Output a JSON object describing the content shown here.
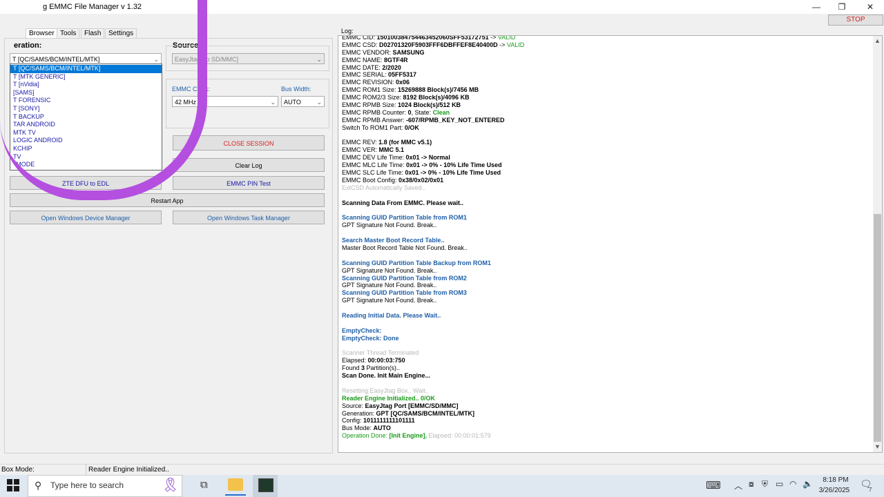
{
  "window": {
    "title": "g EMMC File Manager v 1.32",
    "minimize_glyph": "—",
    "restore_glyph": "❐",
    "close_glyph": "✕",
    "stop_label": "STOP"
  },
  "tabs": [
    "Browser",
    "Tools",
    "Flash",
    "Settings"
  ],
  "left": {
    "generation_label": "eration:",
    "generation_value": "T [QC/SAMS/BCM/INTEL/MTK]",
    "source_label": "Source:",
    "source_value": "EasyJtag Po        SD/MMC]",
    "emmc_clock_label": "EMMC Clock:",
    "emmc_clock_value": "42 MHz",
    "bus_width_label": "Bus Width:",
    "bus_width_value": "AUTO",
    "dropdown_items": [
      "T [QC/SAMS/BCM/INTEL/MTK]",
      "T [MTK GENERIC]",
      "T [nVidia]",
      "[SAMS]",
      "T FORENSIC",
      "T [SONY]",
      "T BACKUP",
      "TAR ANDROID",
      "MTK TV",
      "LOGIC ANDROID",
      "KCHIP",
      "TV",
      "' MODE"
    ],
    "buttons": {
      "close_session": "CLOSE SESSION",
      "clear_log": "Clear Log",
      "zte_dfu": "ZTE DFU to EDL",
      "emmc_pin_test": "EMMC PIN Test",
      "restart_app": "Restart App",
      "open_device_manager": "Open Windows Device Manager",
      "open_task_manager": "Open Windows Task Manager"
    }
  },
  "log": {
    "label": "Log:",
    "lines": [
      {
        "segs": [
          {
            "t": "EMMC CID: "
          },
          {
            "t": "150100384754463452060SFF53172751",
            "c": "b"
          },
          {
            "t": " -> "
          },
          {
            "t": "VALID",
            "c": "gr"
          }
        ]
      },
      {
        "segs": [
          {
            "t": "EMMC CSD: "
          },
          {
            "t": "D02701320F5903FFF6DBFFEF8E40400D",
            "c": "b"
          },
          {
            "t": " -> "
          },
          {
            "t": "VALID",
            "c": "gr"
          }
        ]
      },
      {
        "segs": [
          {
            "t": "EMMC VENDOR: "
          },
          {
            "t": "SAMSUNG",
            "c": "b"
          }
        ]
      },
      {
        "segs": [
          {
            "t": "EMMC NAME: "
          },
          {
            "t": "8GTF4R",
            "c": "b"
          }
        ]
      },
      {
        "segs": [
          {
            "t": "EMMC DATE: "
          },
          {
            "t": "2/2020",
            "c": "b"
          }
        ]
      },
      {
        "segs": [
          {
            "t": "EMMC SERIAL: "
          },
          {
            "t": "05FF5317",
            "c": "b"
          }
        ]
      },
      {
        "segs": [
          {
            "t": "EMMC REVISION: "
          },
          {
            "t": "0x06",
            "c": "b"
          }
        ]
      },
      {
        "segs": [
          {
            "t": "EMMC ROM1 Size: "
          },
          {
            "t": "15269888 Block(s)/7456 MB",
            "c": "b"
          }
        ]
      },
      {
        "segs": [
          {
            "t": "EMMC ROM2/3 Size: "
          },
          {
            "t": "8192 Block(s)/4096 KB",
            "c": "b"
          }
        ]
      },
      {
        "segs": [
          {
            "t": "EMMC RPMB Size: "
          },
          {
            "t": "1024 Block(s)/512 KB",
            "c": "b"
          }
        ]
      },
      {
        "segs": [
          {
            "t": "EMMC RPMB Counter: "
          },
          {
            "t": "0",
            "c": "b"
          },
          {
            "t": ", State: "
          },
          {
            "t": "Clean",
            "c": "grb"
          }
        ]
      },
      {
        "segs": [
          {
            "t": "EMMC RPMB Answer: "
          },
          {
            "t": "-607/RPMB_KEY_NOT_ENTERED",
            "c": "b"
          }
        ]
      },
      {
        "segs": [
          {
            "t": "Switch To ROM1 Part: "
          },
          {
            "t": "0/OK",
            "c": "b"
          }
        ]
      },
      {
        "segs": []
      },
      {
        "segs": [
          {
            "t": "EMMC REV: "
          },
          {
            "t": "1.8 (for MMC v5.1)",
            "c": "b"
          }
        ]
      },
      {
        "segs": [
          {
            "t": "EMMC VER: "
          },
          {
            "t": "MMC 5.1",
            "c": "b"
          }
        ]
      },
      {
        "segs": [
          {
            "t": "EMMC DEV Life Time: "
          },
          {
            "t": "0x01 -> Normal",
            "c": "b"
          }
        ]
      },
      {
        "segs": [
          {
            "t": "EMMC MLC Life Time: "
          },
          {
            "t": "0x01 -> 0% - 10% Life Time Used",
            "c": "b"
          }
        ]
      },
      {
        "segs": [
          {
            "t": "EMMC SLC Life Time: "
          },
          {
            "t": "0x01 -> 0% - 10% Life Time Used",
            "c": "b"
          }
        ]
      },
      {
        "segs": [
          {
            "t": "EMMC Boot Config: "
          },
          {
            "t": "0x38/0x02/0x01",
            "c": "b"
          }
        ]
      },
      {
        "segs": [
          {
            "t": "ExtCSD Automatically Saved..",
            "c": "gy"
          }
        ]
      },
      {
        "segs": []
      },
      {
        "segs": [
          {
            "t": "Scanning Data From EMMC. Please wait..",
            "c": "b"
          }
        ]
      },
      {
        "segs": []
      },
      {
        "segs": [
          {
            "t": "Scanning GUID Partition Table from ROM1",
            "c": "bl"
          }
        ]
      },
      {
        "segs": [
          {
            "t": "GPT Signature Not Found. Break.."
          }
        ]
      },
      {
        "segs": []
      },
      {
        "segs": [
          {
            "t": "Search Master Boot Record Table..",
            "c": "bl"
          }
        ]
      },
      {
        "segs": [
          {
            "t": "Master Boot Record Table Not Found. Break.."
          }
        ]
      },
      {
        "segs": []
      },
      {
        "segs": [
          {
            "t": "Scanning GUID Partition Table Backup from ROM1",
            "c": "bl"
          }
        ]
      },
      {
        "segs": [
          {
            "t": "GPT Signature Not Found. Break.."
          }
        ]
      },
      {
        "segs": [
          {
            "t": "Scanning GUID Partition Table from ROM2",
            "c": "bl"
          }
        ]
      },
      {
        "segs": [
          {
            "t": "GPT Signature Not Found. Break.."
          }
        ]
      },
      {
        "segs": [
          {
            "t": "Scanning GUID Partition Table from ROM3",
            "c": "bl"
          }
        ]
      },
      {
        "segs": [
          {
            "t": "GPT Signature Not Found. Break.."
          }
        ]
      },
      {
        "segs": []
      },
      {
        "segs": [
          {
            "t": "Reading Initial Data. Please Wait..",
            "c": "bl"
          }
        ]
      },
      {
        "segs": []
      },
      {
        "segs": [
          {
            "t": "EmptyCheck:",
            "c": "bl"
          }
        ]
      },
      {
        "segs": [
          {
            "t": "EmptyCheck: Done",
            "c": "bl"
          }
        ]
      },
      {
        "segs": []
      },
      {
        "segs": [
          {
            "t": "Scanner Thread Terminated",
            "c": "gy"
          }
        ]
      },
      {
        "segs": [
          {
            "t": "Elapsed: "
          },
          {
            "t": "00:00:03:750",
            "c": "b"
          }
        ]
      },
      {
        "segs": [
          {
            "t": "Found "
          },
          {
            "t": "3",
            "c": "b"
          },
          {
            "t": " Partition(s).."
          }
        ]
      },
      {
        "segs": [
          {
            "t": "Scan Done. Init Main Engine...",
            "c": "b"
          }
        ]
      },
      {
        "segs": []
      },
      {
        "segs": [
          {
            "t": "Resetting EasyJtag Box.. Wait..",
            "c": "gy"
          }
        ]
      },
      {
        "segs": [
          {
            "t": "Reader Engine Initialized.. 0/OK",
            "c": "grb"
          }
        ]
      },
      {
        "segs": [
          {
            "t": "Source: "
          },
          {
            "t": "EasyJtag Port [EMMC/SD/MMC]",
            "c": "b"
          }
        ]
      },
      {
        "segs": [
          {
            "t": "Generation: "
          },
          {
            "t": "GPT [QC/SAMS/BCM/INTEL/MTK]",
            "c": "b"
          }
        ]
      },
      {
        "segs": [
          {
            "t": "Config: "
          },
          {
            "t": "1011111111101111",
            "c": "b"
          }
        ]
      },
      {
        "segs": [
          {
            "t": "Bus Mode: "
          },
          {
            "t": "AUTO",
            "c": "b"
          }
        ]
      },
      {
        "segs": [
          {
            "t": "Operation Done: ",
            "c": "gr"
          },
          {
            "t": "[Init Engine],",
            "c": "grb"
          },
          {
            "t": " Elapsed: 00:00:01:579",
            "c": "gy"
          }
        ]
      }
    ]
  },
  "status": {
    "box_mode_label": "Box Mode:",
    "message": "Reader Engine Initialized.."
  },
  "taskbar": {
    "search_placeholder": "Type here to search",
    "time": "8:18 PM",
    "date": "3/26/2025",
    "notification_count": "7"
  }
}
